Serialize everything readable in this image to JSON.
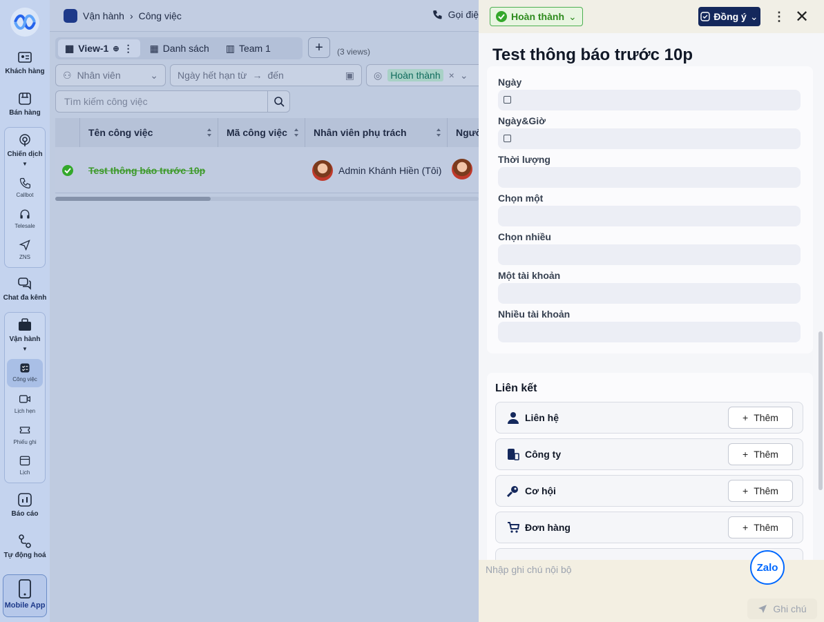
{
  "breadcrumb": {
    "section": "Vận hành",
    "page": "Công việc"
  },
  "call_label": "Gọi điệ",
  "rail": {
    "items": {
      "customers": "Khách hàng",
      "sales": "Bán hàng",
      "campaigns": "Chiến dịch",
      "callbot": "Callbot",
      "telesale": "Telesale",
      "zns": "ZNS",
      "omnichat": "Chat đa kênh",
      "operations": "Vận hành",
      "tasks": "Công việc",
      "appointments": "Lịch hẹn",
      "tickets": "Phiếu ghi",
      "calendar": "Lịch",
      "reports": "Báo cáo",
      "automation": "Tự động hoá",
      "mobile_app": "Mobile App"
    }
  },
  "views": {
    "tabs": [
      {
        "label": "View-1"
      },
      {
        "label": "Danh sách"
      },
      {
        "label": "Team 1"
      }
    ],
    "count": "(3 views)"
  },
  "filters": {
    "staff_placeholder": "Nhân viên",
    "date_from_placeholder": "Ngày hết hạn từ",
    "date_to_placeholder": "đến",
    "status_tag": "Hoàn thành",
    "search_placeholder": "Tìm kiếm công việc"
  },
  "table": {
    "columns": [
      "Tên công việc",
      "Mã công việc",
      "Nhân viên phụ trách",
      "Người"
    ],
    "rows": [
      {
        "name": "Test thông báo trước 10p",
        "code": "",
        "assignee": "Admin Khánh Hiền (Tôi)"
      }
    ]
  },
  "drawer": {
    "status": "Hoàn thành",
    "agree_label": "Đồng ý",
    "title": "Test thông báo trước 10p",
    "fields": [
      {
        "label": "Ngày"
      },
      {
        "label": "Ngày&Giờ"
      },
      {
        "label": "Thời lượng"
      },
      {
        "label": "Chọn một"
      },
      {
        "label": "Chọn nhiều"
      },
      {
        "label": "Một tài khoản"
      },
      {
        "label": "Nhiều tài khoản"
      }
    ],
    "links_title": "Liên kết",
    "links": [
      {
        "label": "Liên hệ",
        "add": "Thêm"
      },
      {
        "label": "Công ty",
        "add": "Thêm"
      },
      {
        "label": "Cơ hội",
        "add": "Thêm"
      },
      {
        "label": "Đơn hàng",
        "add": "Thêm"
      }
    ],
    "note_placeholder": "Nhập ghi chú nội bộ",
    "send_label": "Ghi chú",
    "zalo_label": "Zalo"
  },
  "colors": {
    "brand": "#14285c",
    "success": "#34a82b",
    "zalo": "#0068ff"
  }
}
